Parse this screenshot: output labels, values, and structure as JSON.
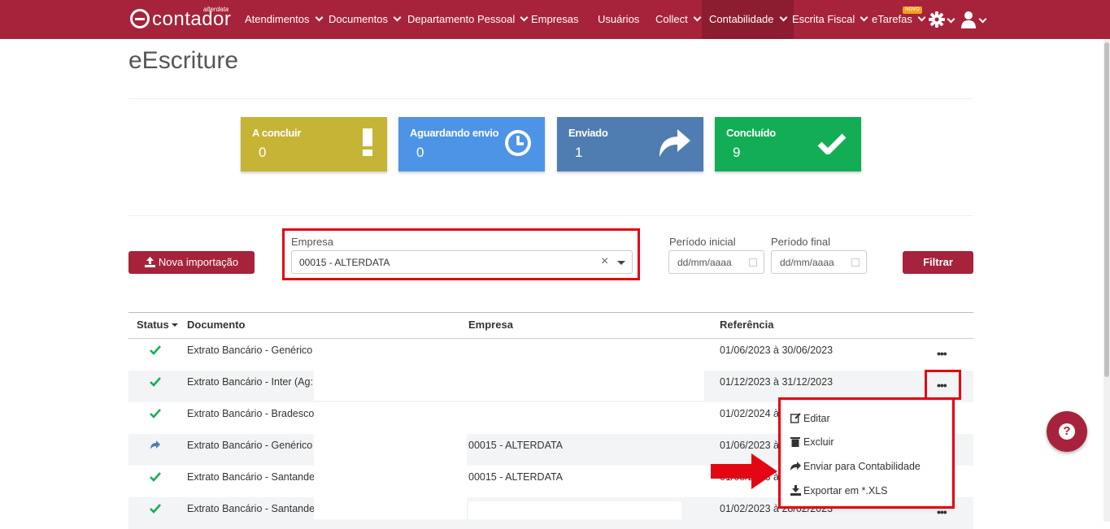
{
  "nav": {
    "logo_brand": "alterdata",
    "logo_text": "contador",
    "items": [
      {
        "label": "Atendimentos",
        "chevron": true
      },
      {
        "label": "Documentos",
        "chevron": true
      },
      {
        "label": "Departamento Pessoal",
        "chevron": true
      },
      {
        "label": "Empresas",
        "chevron": false
      },
      {
        "label": "Usuários",
        "chevron": false
      },
      {
        "label": "Collect",
        "chevron": true
      },
      {
        "label": "Contabilidade",
        "chevron": true,
        "active": true
      },
      {
        "label": "Escrita Fiscal",
        "chevron": true
      },
      {
        "label": "eTarefas",
        "chevron": true
      }
    ],
    "badge": "NOVO"
  },
  "page": {
    "title": "eEscriture"
  },
  "cards": [
    {
      "label": "A concluir",
      "value": "0",
      "color": "#c5b435",
      "icon": "exclamation-icon"
    },
    {
      "label": "Aguardando envio",
      "value": "0",
      "color": "#4d94e6",
      "icon": "clock-icon"
    },
    {
      "label": "Enviado",
      "value": "1",
      "color": "#4f7db2",
      "icon": "share-arrow-icon"
    },
    {
      "label": "Concluído",
      "value": "9",
      "color": "#12ad55",
      "icon": "check-icon"
    }
  ],
  "filter": {
    "new_import": "Nova importação",
    "empresa_label": "Empresa",
    "empresa_value": "00015 - ALTERDATA",
    "periodo_inicial_label": "Período inicial",
    "periodo_final_label": "Período final",
    "date_placeholder": "dd/mm/aaaa",
    "filter_button": "Filtrar"
  },
  "table": {
    "headers": {
      "status": "Status",
      "documento": "Documento",
      "empresa": "Empresa",
      "referencia": "Referência"
    },
    "rows": [
      {
        "status": "check",
        "documento": "Extrato Bancário - Genérico (",
        "empresa": "",
        "referencia": "01/06/2023 à 30/06/2023"
      },
      {
        "status": "check",
        "documento": "Extrato Bancário - Inter (Ag:",
        "empresa": "",
        "referencia": "01/12/2023 à 31/12/2023"
      },
      {
        "status": "check",
        "documento": "Extrato Bancário - Bradesco",
        "empresa": "",
        "referencia": "01/02/2024 à"
      },
      {
        "status": "sent",
        "documento": "Extrato Bancário - Genérico (",
        "empresa": "00015 - ALTERDATA",
        "referencia": "01/06/2023 à"
      },
      {
        "status": "check",
        "documento": "Extrato Bancário - Santander",
        "empresa": "00015 - ALTERDATA",
        "referencia": "01/05/2023 à"
      },
      {
        "status": "check",
        "documento": "Extrato Bancário - Santander",
        "empresa": "",
        "referencia": "01/02/2023 à 28/02/2023"
      }
    ]
  },
  "dropdown": {
    "edit": "Editar",
    "delete": "Excluir",
    "send": "Enviar para Contabilidade",
    "export": "Exportar em *.XLS"
  },
  "help": "?"
}
